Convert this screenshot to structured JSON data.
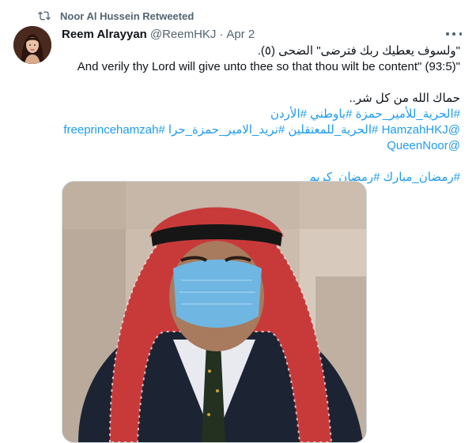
{
  "retweet": {
    "icon": "retweet-icon",
    "text": "Noor Al Hussein Retweeted"
  },
  "author": {
    "name": "Reem Alrayyan",
    "handle": "@ReemHKJ",
    "separator": "·",
    "date": "Apr 2",
    "avatar_icon": "avatar-icon"
  },
  "more_icon": "more-icon",
  "body": {
    "quote_arabic": "\"ولسوف يعطيك ربك فترضى\" الضحى (٥).",
    "quote_english": "And verily thy Lord will give unto thee so that thou wilt be content\" (93:5)\"",
    "prayer": "حماك الله من كل شر..",
    "hashtags_line1": "#الحرية_للأمير_حمزة #باوطني #الأردن",
    "hashtags_line2": "@HamzahHKJ #الحرية_للمعتقلين #نريد_الامير_حمزة_حرا #freeprincehamzah",
    "mention_line": "@QueenNoor",
    "ramadan_tags": "#رمضان_مبارك #رمضان_كريم"
  },
  "media": {
    "image_icon": "photo-of-man-in-red-keffiyeh-and-face-mask"
  },
  "colors": {
    "link": "#1d9bf0",
    "secondary_text": "#536471",
    "primary_text": "#0f1419",
    "border": "#cfd9de"
  }
}
